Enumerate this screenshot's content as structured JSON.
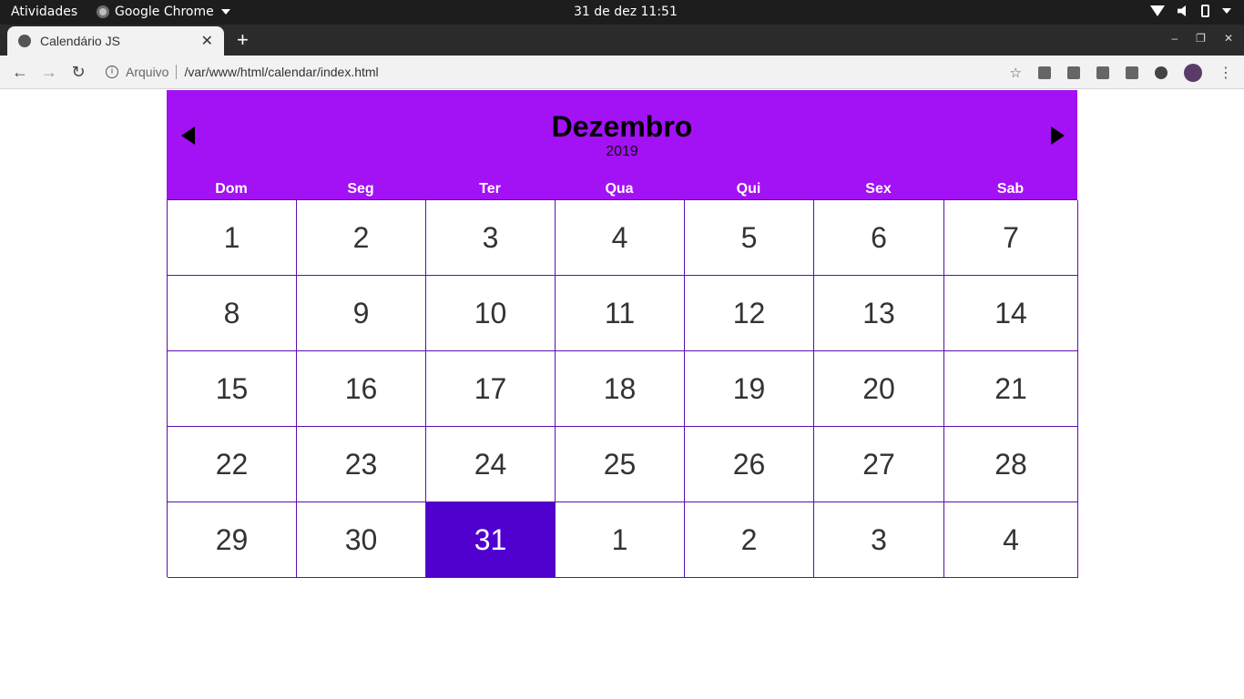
{
  "system": {
    "activities": "Atividades",
    "app_name": "Google Chrome",
    "clock": "31 de dez  11:51"
  },
  "browser": {
    "tab_title": "Calendário JS",
    "tab_close": "✕",
    "new_tab": "+",
    "scheme_label": "Arquivo",
    "url": "/var/www/html/calendar/index.html",
    "window_controls": [
      "–",
      "❐",
      "✕"
    ]
  },
  "calendar": {
    "month": "Dezembro",
    "year": "2019",
    "prev_symbol": "",
    "next_symbol": "",
    "accent_color": "#a311f5",
    "today_color": "#5000cf",
    "weekdays": [
      "Dom",
      "Seg",
      "Ter",
      "Qua",
      "Qui",
      "Sex",
      "Sab"
    ],
    "days": [
      "1",
      "2",
      "3",
      "4",
      "5",
      "6",
      "7",
      "8",
      "9",
      "10",
      "11",
      "12",
      "13",
      "14",
      "15",
      "16",
      "17",
      "18",
      "19",
      "20",
      "21",
      "22",
      "23",
      "24",
      "25",
      "26",
      "27",
      "28",
      "29",
      "30",
      "31",
      "1",
      "2",
      "3",
      "4"
    ],
    "today_index": 30
  }
}
